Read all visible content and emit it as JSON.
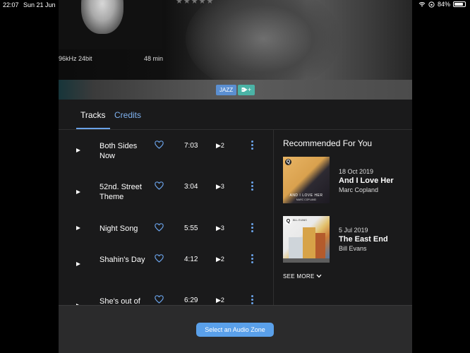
{
  "status_bar": {
    "time": "22:07",
    "date": "Sun 21 Jun",
    "battery": "84%",
    "battery_level": 0.84
  },
  "album": {
    "format": "96kHz 24bit",
    "duration": "48 min",
    "rating_stars": "★★★★★",
    "genre": "JAZZ",
    "add_tag": "+"
  },
  "tabs": [
    {
      "label": "Tracks",
      "active": true
    },
    {
      "label": "Credits",
      "active": false
    }
  ],
  "tracks": [
    {
      "title": "Both Sides Now",
      "duration": "7:03",
      "plays": "2"
    },
    {
      "title": "52nd. Street Theme",
      "duration": "3:04",
      "plays": "3"
    },
    {
      "title": "Night Song",
      "duration": "5:55",
      "plays": "3"
    },
    {
      "title": "Shahin's Day",
      "duration": "4:12",
      "plays": "2"
    },
    {
      "title": "She's out of",
      "duration": "6:29",
      "plays": "2"
    }
  ],
  "recommended": {
    "title": "Recommended For You",
    "items": [
      {
        "date": "18 Oct 2019",
        "title": "And I Love Her",
        "artist": "Marc Copland",
        "cover_text": "AND I LOVE HER",
        "cover_sub": "MARC COPLAND"
      },
      {
        "date": "5 Jul 2019",
        "title": "The East End",
        "artist": "Bill Evans",
        "cover_text": "BILL EVANS"
      }
    ],
    "see_more": "SEE MORE"
  },
  "bottom": {
    "zone_button": "Select an Audio Zone"
  },
  "colors": {
    "accent": "#6aa2e8",
    "genre_badge": "#5b8fd1",
    "tag_add": "#4bb3a6",
    "button": "#5aa0ea"
  }
}
